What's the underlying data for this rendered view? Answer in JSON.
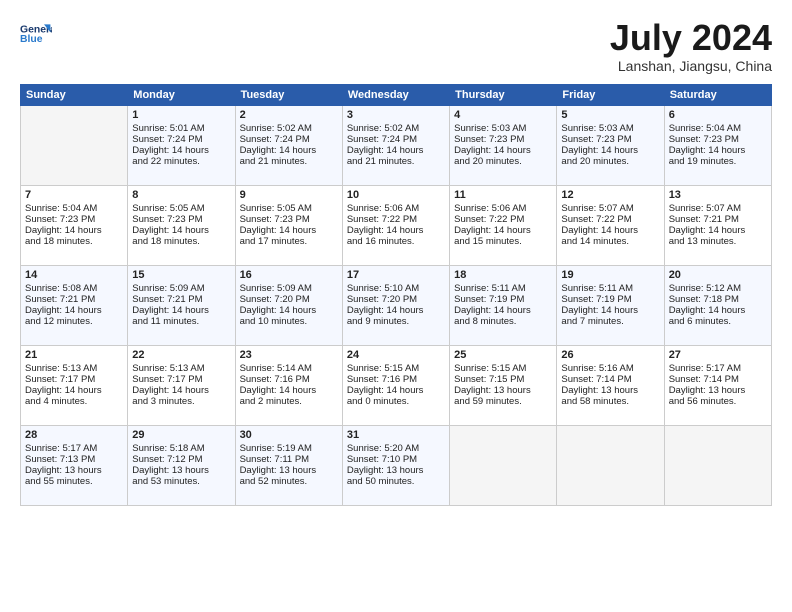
{
  "header": {
    "title": "July 2024",
    "location": "Lanshan, Jiangsu, China"
  },
  "weekdays": [
    "Sunday",
    "Monday",
    "Tuesday",
    "Wednesday",
    "Thursday",
    "Friday",
    "Saturday"
  ],
  "weeks": [
    [
      {
        "day": "",
        "content": ""
      },
      {
        "day": "1",
        "content": "Sunrise: 5:01 AM\nSunset: 7:24 PM\nDaylight: 14 hours\nand 22 minutes."
      },
      {
        "day": "2",
        "content": "Sunrise: 5:02 AM\nSunset: 7:24 PM\nDaylight: 14 hours\nand 21 minutes."
      },
      {
        "day": "3",
        "content": "Sunrise: 5:02 AM\nSunset: 7:24 PM\nDaylight: 14 hours\nand 21 minutes."
      },
      {
        "day": "4",
        "content": "Sunrise: 5:03 AM\nSunset: 7:23 PM\nDaylight: 14 hours\nand 20 minutes."
      },
      {
        "day": "5",
        "content": "Sunrise: 5:03 AM\nSunset: 7:23 PM\nDaylight: 14 hours\nand 20 minutes."
      },
      {
        "day": "6",
        "content": "Sunrise: 5:04 AM\nSunset: 7:23 PM\nDaylight: 14 hours\nand 19 minutes."
      }
    ],
    [
      {
        "day": "7",
        "content": "Sunrise: 5:04 AM\nSunset: 7:23 PM\nDaylight: 14 hours\nand 18 minutes."
      },
      {
        "day": "8",
        "content": "Sunrise: 5:05 AM\nSunset: 7:23 PM\nDaylight: 14 hours\nand 18 minutes."
      },
      {
        "day": "9",
        "content": "Sunrise: 5:05 AM\nSunset: 7:23 PM\nDaylight: 14 hours\nand 17 minutes."
      },
      {
        "day": "10",
        "content": "Sunrise: 5:06 AM\nSunset: 7:22 PM\nDaylight: 14 hours\nand 16 minutes."
      },
      {
        "day": "11",
        "content": "Sunrise: 5:06 AM\nSunset: 7:22 PM\nDaylight: 14 hours\nand 15 minutes."
      },
      {
        "day": "12",
        "content": "Sunrise: 5:07 AM\nSunset: 7:22 PM\nDaylight: 14 hours\nand 14 minutes."
      },
      {
        "day": "13",
        "content": "Sunrise: 5:07 AM\nSunset: 7:21 PM\nDaylight: 14 hours\nand 13 minutes."
      }
    ],
    [
      {
        "day": "14",
        "content": "Sunrise: 5:08 AM\nSunset: 7:21 PM\nDaylight: 14 hours\nand 12 minutes."
      },
      {
        "day": "15",
        "content": "Sunrise: 5:09 AM\nSunset: 7:21 PM\nDaylight: 14 hours\nand 11 minutes."
      },
      {
        "day": "16",
        "content": "Sunrise: 5:09 AM\nSunset: 7:20 PM\nDaylight: 14 hours\nand 10 minutes."
      },
      {
        "day": "17",
        "content": "Sunrise: 5:10 AM\nSunset: 7:20 PM\nDaylight: 14 hours\nand 9 minutes."
      },
      {
        "day": "18",
        "content": "Sunrise: 5:11 AM\nSunset: 7:19 PM\nDaylight: 14 hours\nand 8 minutes."
      },
      {
        "day": "19",
        "content": "Sunrise: 5:11 AM\nSunset: 7:19 PM\nDaylight: 14 hours\nand 7 minutes."
      },
      {
        "day": "20",
        "content": "Sunrise: 5:12 AM\nSunset: 7:18 PM\nDaylight: 14 hours\nand 6 minutes."
      }
    ],
    [
      {
        "day": "21",
        "content": "Sunrise: 5:13 AM\nSunset: 7:17 PM\nDaylight: 14 hours\nand 4 minutes."
      },
      {
        "day": "22",
        "content": "Sunrise: 5:13 AM\nSunset: 7:17 PM\nDaylight: 14 hours\nand 3 minutes."
      },
      {
        "day": "23",
        "content": "Sunrise: 5:14 AM\nSunset: 7:16 PM\nDaylight: 14 hours\nand 2 minutes."
      },
      {
        "day": "24",
        "content": "Sunrise: 5:15 AM\nSunset: 7:16 PM\nDaylight: 14 hours\nand 0 minutes."
      },
      {
        "day": "25",
        "content": "Sunrise: 5:15 AM\nSunset: 7:15 PM\nDaylight: 13 hours\nand 59 minutes."
      },
      {
        "day": "26",
        "content": "Sunrise: 5:16 AM\nSunset: 7:14 PM\nDaylight: 13 hours\nand 58 minutes."
      },
      {
        "day": "27",
        "content": "Sunrise: 5:17 AM\nSunset: 7:14 PM\nDaylight: 13 hours\nand 56 minutes."
      }
    ],
    [
      {
        "day": "28",
        "content": "Sunrise: 5:17 AM\nSunset: 7:13 PM\nDaylight: 13 hours\nand 55 minutes."
      },
      {
        "day": "29",
        "content": "Sunrise: 5:18 AM\nSunset: 7:12 PM\nDaylight: 13 hours\nand 53 minutes."
      },
      {
        "day": "30",
        "content": "Sunrise: 5:19 AM\nSunset: 7:11 PM\nDaylight: 13 hours\nand 52 minutes."
      },
      {
        "day": "31",
        "content": "Sunrise: 5:20 AM\nSunset: 7:10 PM\nDaylight: 13 hours\nand 50 minutes."
      },
      {
        "day": "",
        "content": ""
      },
      {
        "day": "",
        "content": ""
      },
      {
        "day": "",
        "content": ""
      }
    ]
  ]
}
